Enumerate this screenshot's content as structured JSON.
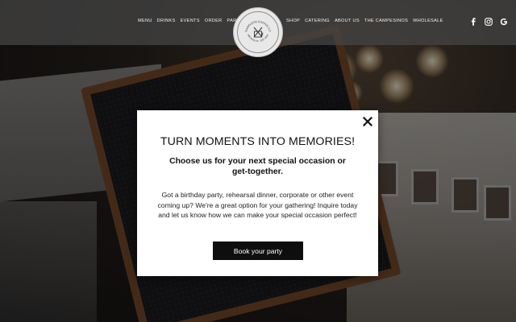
{
  "header": {
    "nav_left": [
      "MENU",
      "DRINKS",
      "EVENTS",
      "ORDER",
      "PARTIES"
    ],
    "nav_right": [
      "SHOP",
      "CATERING",
      "ABOUT US",
      "THE CAMPESINOS",
      "WHOLESALE"
    ],
    "logo": {
      "text_top": "NAMELESS COFFEE CO",
      "text_bottom": "WICHITA KS · EST 2016",
      "icon": "coffee-logo-icon"
    },
    "social_icons": [
      "facebook-icon",
      "instagram-icon",
      "google-icon"
    ]
  },
  "modal": {
    "title": "TURN MOMENTS INTO MEMORIES!",
    "subtitle": "Choose us for your next special occasion or get-together.",
    "body": "Got a birthday party, rehearsal dinner, corporate or other event coming up? We're a great option for your gathering! Inquire today and let us know how we can make your special occasion perfect!",
    "button_label": "Book your party",
    "close_icon": "close-icon"
  },
  "colors": {
    "header_bg": "#464646",
    "button_bg": "#0e0e0e",
    "modal_bg": "#ffffff"
  }
}
